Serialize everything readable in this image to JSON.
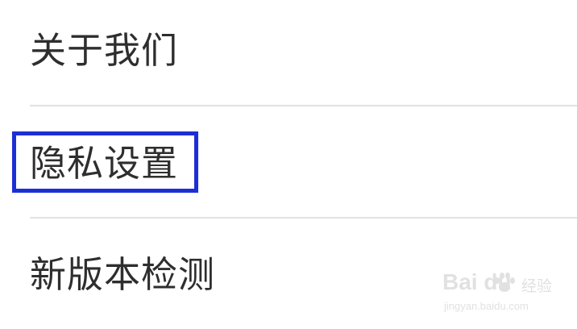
{
  "settings": {
    "items": [
      {
        "label": "关于我们"
      },
      {
        "label": "隐私设置"
      },
      {
        "label": "新版本检测"
      }
    ]
  },
  "highlight": {
    "target": "隐私设置",
    "color": "#1c2fd6"
  },
  "colors": {
    "background": "#ffffff",
    "text": "#2e2e2e",
    "divider": "#e2e2e2"
  },
  "watermark": {
    "logo_text": "Bai  du",
    "cn_text": "经验",
    "url": "jingyan.baidu.com",
    "icon": "paw-icon"
  }
}
